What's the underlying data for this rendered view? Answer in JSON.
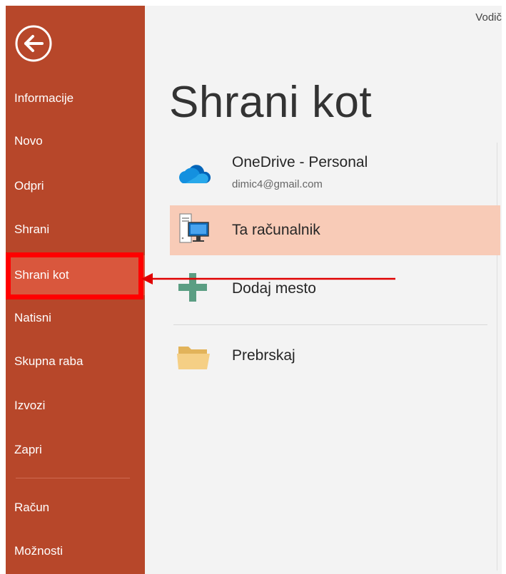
{
  "sidebar": {
    "back_icon": "back-arrow-icon",
    "items": [
      {
        "label": "Informacije",
        "selected": false
      },
      {
        "label": "Novo",
        "selected": false
      },
      {
        "label": "Odpri",
        "selected": false
      },
      {
        "label": "Shrani",
        "selected": false
      },
      {
        "label": "Shrani kot",
        "selected": true
      },
      {
        "label": "Natisni",
        "selected": false
      },
      {
        "label": "Skupna raba",
        "selected": false
      },
      {
        "label": "Izvozi",
        "selected": false
      },
      {
        "label": "Zapri",
        "selected": false
      },
      {
        "label": "Račun",
        "selected": false
      },
      {
        "label": "Možnosti",
        "selected": false
      }
    ]
  },
  "header": {
    "right_link": "Vodič"
  },
  "main": {
    "title": "Shrani kot",
    "locations": [
      {
        "title": "OneDrive - Personal",
        "subtitle": "dimic4@gmail.com",
        "icon": "onedrive-cloud-icon"
      },
      {
        "title": "Ta računalnik",
        "icon": "computer-icon",
        "active": true
      },
      {
        "title": "Dodaj mesto",
        "icon": "add-place-plus-icon"
      },
      {
        "title": "Prebrskaj",
        "icon": "folder-icon"
      }
    ]
  },
  "colors": {
    "sidebar_bg": "#b7472a",
    "sidebar_selected": "#d9573d",
    "main_bg": "#f3f3f3",
    "active_location": "#f8cbb7",
    "annotation_red": "#ff0000"
  }
}
